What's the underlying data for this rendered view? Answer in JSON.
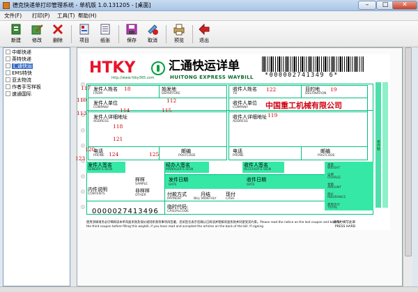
{
  "window": {
    "title": "德克快递单打印管理系统 - 单机版 1.0.131205 - [桌面]",
    "min": "–",
    "max": "□",
    "close": "✕"
  },
  "menu": {
    "file": "文件(F)",
    "print": "打印(P)",
    "tools": "工具(T)",
    "help": "帮助(H)"
  },
  "toolbar": {
    "new": "新建",
    "edit": "修改",
    "delete": "删除",
    "item": "项目",
    "paper": "纸张",
    "save": "保存",
    "cancel": "取消",
    "preview": "预览",
    "exit": "退出"
  },
  "sidebar": {
    "items": [
      "中邮快递",
      "英特快递",
      "汇通快运",
      "EMS特快",
      "亚太物流",
      "作者手写样板",
      "速通国际"
    ],
    "selected_index": 2
  },
  "colors": {
    "accent_green": "#36e8a6",
    "red": "#d00010",
    "brand_red": "#e8132c"
  },
  "waybill": {
    "brand": "HTKY",
    "url": "http://www.htky365.com",
    "title_cn": "汇通快运详单",
    "title_en": "HUITONG EXPRESS WAYBILL",
    "barcode_number": "*000002741349 6*",
    "company": "中国重工机械有限公司",
    "waybill_number": "0000027413496",
    "sender_name": "发件人姓名",
    "sender_name_en": "FROM",
    "origin": "始发地",
    "origin_en": "DEPARTURE",
    "sender_company": "发件人单位",
    "sender_company_en": "COMPANY",
    "sender_address": "发件人详细地址",
    "sender_address_en": "ADDRESS",
    "sender_phone": "电话",
    "sender_phone_en": "PHONE",
    "sender_postcode": "邮编",
    "sender_postcode_en": "POSTCODE",
    "recipient_name": "收件人姓名",
    "recipient_name_en": "TO",
    "destination": "目的地",
    "destination_en": "DESTINATION",
    "recipient_company": "收件人单位",
    "recipient_company_en": "COMPANY",
    "recipient_address": "收件人详细地址",
    "recipient_address_en": "ADDRESS",
    "recipient_phone": "电话",
    "recipient_phone_en": "PHONE",
    "recipient_postcode": "邮编",
    "recipient_postcode_en": "POSTCODE",
    "sender_sign": "发件人签名",
    "sender_sign_en": "SENDER'S SIGN",
    "handler_sign": "经办人签名",
    "handler_sign_en": "MANAGER'S SIGN",
    "receiver_sign": "收件人签名",
    "receiver_sign_en": "RECEIVER'S SIGN",
    "ship_date": "发件日期",
    "ship_date_en": "DATE",
    "receive_date": "收件日期",
    "receive_date_en": "DATE",
    "contents": "内件说明",
    "contents_en": "CONTENTS",
    "sample": "样样",
    "sample_en": "SAMPLE",
    "non_sample": "非样样",
    "non_sample_en": "OTHER",
    "payment": "付款方式",
    "payment_en": "PAYMENT",
    "monthly": "月结",
    "monthly_en": "BILL MONTHLY",
    "cash": "现付",
    "cash_en": "CASH",
    "cod": "临时代码:",
    "cod_en": "CASUALCODE",
    "weight": "重量",
    "weight_en": "WEIGHT",
    "freight": "运费",
    "freight_en": "CHARGE",
    "amount": "金额",
    "amount_en": "AMOUNT",
    "insurance": "保价",
    "insurance_en": "INSURANCE",
    "total": "费用合计",
    "total_en": "TOTAL",
    "footer": "使用须填请务必仔细阅读本单背面条款及保价规则条款等事项再签署，您如签名表示您确认已阅读并理解背面条款并同意受其约束。Please read the notice on the last coupon and back of the third coupon before filling this waybill, if you have read and accepted the articles on the back of the bill. If signing",
    "press_hard": "请用力填写此单\nPRESS HARD",
    "side_tab": "寄件联",
    "field_numbers": {
      "n117": "117",
      "n118a": "18",
      "n112": "112",
      "n122": "122",
      "n19": "19",
      "n110": "110",
      "n114": "114",
      "n115": "115",
      "n113": "113",
      "n118": "118",
      "n119": "119",
      "n121": "121",
      "n120": "120",
      "n124": "124",
      "n125": "125",
      "n123": "123"
    }
  }
}
